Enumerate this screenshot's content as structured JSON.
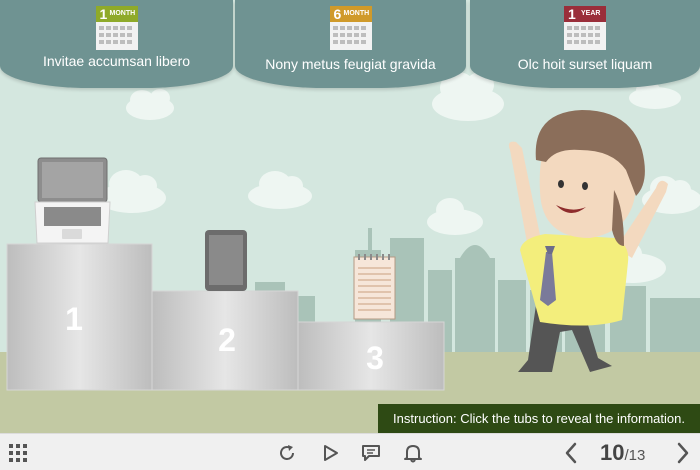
{
  "tabs": [
    {
      "label": "Invitae accumsan libero",
      "calendar_number": "1",
      "calendar_unit": "MONTH",
      "color": "#8faa2a"
    },
    {
      "label": "Nony metus feugiat gravida",
      "calendar_number": "6",
      "calendar_unit": "MONTH",
      "color": "#d09a2a"
    },
    {
      "label": "Olc hoit surset liquam",
      "calendar_number": "1",
      "calendar_unit": "YEAR",
      "color": "#9a2e3a"
    }
  ],
  "podium": {
    "first": "1",
    "second": "2",
    "third": "3"
  },
  "instruction": "Instruction: Click the tubs to reveal the information.",
  "player": {
    "menu_icon": "grid-menu-icon",
    "replay_icon": "replay-icon",
    "play_icon": "play-icon",
    "transcript_icon": "chat-icon",
    "notification_icon": "bell-icon",
    "prev_icon": "chevron-left-icon",
    "next_icon": "chevron-right-icon",
    "current_page": "10",
    "separator": "/",
    "total_pages": "13"
  },
  "colors": {
    "background": "#d4e7df",
    "tab": "#6f9392",
    "instruction_bg": "#2e4a14",
    "ground": "#c2c9a3",
    "skyline": "#a9c3b8"
  }
}
